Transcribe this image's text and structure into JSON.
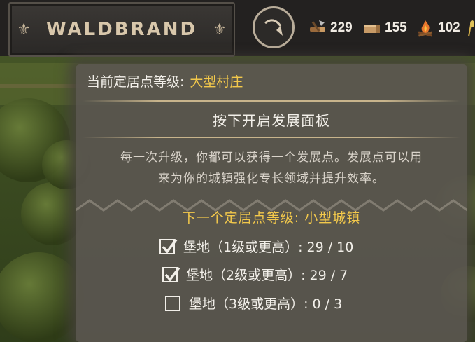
{
  "topbar": {
    "title": "WALDBRAND",
    "resources": [
      {
        "icon": "logs-axe-icon",
        "value": "229"
      },
      {
        "icon": "planks-icon",
        "value": "155"
      },
      {
        "icon": "campfire-icon",
        "value": "102"
      }
    ]
  },
  "panel": {
    "current_label": "当前定居点等级:",
    "current_value": "大型村庄",
    "press_hint": "按下开启发展面板",
    "description_line1": "每一次升级，你都可以获得一个发展点。发展点可以用",
    "description_line2": "来为你的城镇强化专长领域并提升效率。",
    "next_level": "下一个定居点等级: 小型城镇",
    "requirements": [
      {
        "label": "堡地（1级或更高）: 29 / 10",
        "checked": true
      },
      {
        "label": "堡地（2级或更高）: 29 / 7",
        "checked": true
      },
      {
        "label": "堡地（3级或更高）: 0 / 3",
        "checked": false
      }
    ]
  },
  "colors": {
    "accent": "#f2c84b",
    "panel_bg": "#5a5650",
    "text": "#f2efe9"
  }
}
